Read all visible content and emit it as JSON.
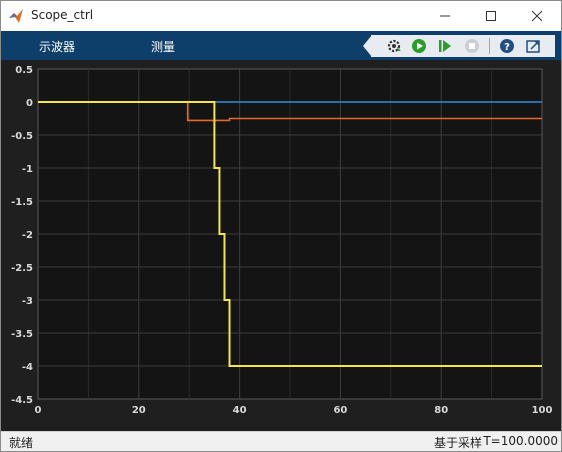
{
  "window": {
    "title": "Scope_ctrl"
  },
  "toolstrip": {
    "tabs": [
      "示波器",
      "测量"
    ],
    "buttons": [
      "settings-icon",
      "run-icon",
      "step-forward-icon",
      "stop-icon",
      "help-icon",
      "undock-icon"
    ]
  },
  "status": {
    "left": "就绪",
    "mode": "基于采样",
    "time": "T=100.0000"
  },
  "colors": {
    "toolstrip": "#0e3f6b",
    "plot_bg": "#141414",
    "grid": "#3d3d3d",
    "series": [
      "#2f8fd8",
      "#e8682a",
      "#f2e64b"
    ]
  },
  "chart_data": {
    "type": "line",
    "title": "",
    "xlabel": "",
    "ylabel": "",
    "xlim": [
      0,
      100
    ],
    "ylim": [
      -4.5,
      0.5
    ],
    "xticks": [
      0,
      20,
      40,
      60,
      80,
      100
    ],
    "yticks": [
      0.5,
      0,
      -0.5,
      -1,
      -1.5,
      -2,
      -2.5,
      -3,
      -3.5,
      -4,
      -4.5
    ],
    "grid": true,
    "series": [
      {
        "color": "#2f8fd8",
        "step": true,
        "x": [
          0,
          35,
          100
        ],
        "y": [
          0,
          0,
          0
        ]
      },
      {
        "color": "#e8682a",
        "step": true,
        "x": [
          0,
          29.7,
          37.5,
          38,
          100
        ],
        "y": [
          0,
          -0.28,
          -0.28,
          -0.25,
          -0.25
        ]
      },
      {
        "color": "#f2e64b",
        "step": true,
        "x": [
          0,
          35,
          36,
          37,
          38,
          100
        ],
        "y": [
          0,
          -1,
          -2,
          -3,
          -4,
          -4
        ]
      }
    ]
  }
}
